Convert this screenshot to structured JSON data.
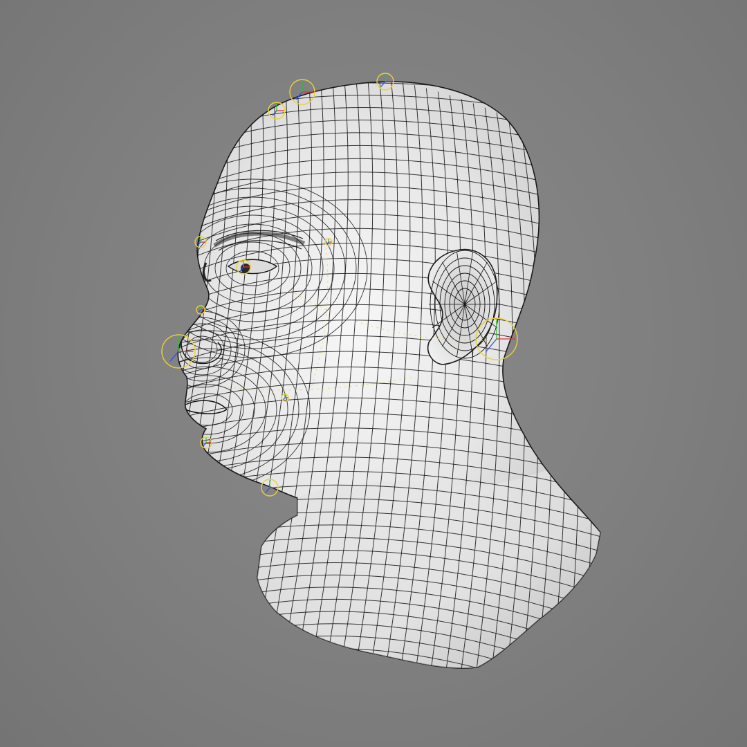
{
  "viewport": {
    "background_color": "#7d7d7d",
    "mesh_fill_color": "#e9e9e9",
    "mesh_shade_color": "#b9b9b9",
    "wire_color": "#141414",
    "rig_control_color": "#e8d23a",
    "axis_colors": {
      "x": "#d93030",
      "y": "#38b838",
      "z": "#3050d8"
    }
  },
  "icons": {
    "head_mesh": "head-mesh-icon",
    "rig_control": "rig-control-icon",
    "transform_gizmo": "transform-gizmo-icon"
  }
}
